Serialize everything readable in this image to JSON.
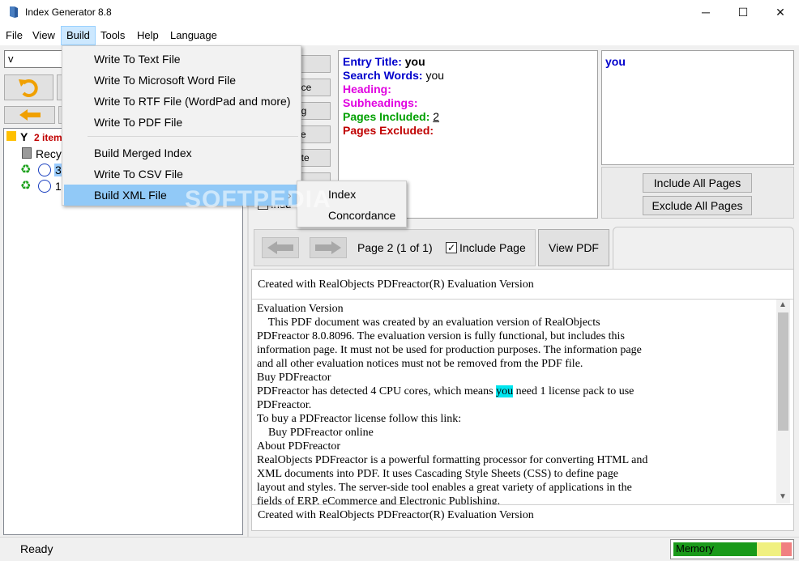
{
  "window": {
    "title": "Index Generator 8.8",
    "minimize": "─",
    "maximize": "☐",
    "close": "✕"
  },
  "menubar": {
    "items": [
      "File",
      "View",
      "Build",
      "Tools",
      "Help",
      "Language"
    ]
  },
  "left": {
    "combo_value": "v",
    "tree_root_letter": "Y",
    "tree_root_count": "2 item",
    "tree_item_recycle": "Recy",
    "tree_item_1": "3",
    "tree_item_2": "1"
  },
  "mid_buttons": [
    "y",
    "nce",
    "ng",
    "se",
    "ate",
    ""
  ],
  "mid_checkbox_label": "Indu",
  "entry": {
    "title_label": "Entry Title:",
    "title_value": "you",
    "search_label": "Search Words:",
    "search_value": "you",
    "heading_label": "Heading:",
    "subheadings_label": "Subheadings:",
    "included_label": "Pages Included:",
    "included_value": "2",
    "excluded_label": "Pages Excluded:",
    "colors": {
      "title": "#0000cc",
      "heading": "#e000e0",
      "included": "#00a000",
      "excluded": "#c00000"
    }
  },
  "right_list": {
    "item": "you"
  },
  "pages_buttons": {
    "include_all": "Include All Pages",
    "exclude_all": "Exclude All Pages"
  },
  "page_nav": {
    "page_label": "Page 2 (1 of 1)",
    "include_page_label": "Include Page",
    "include_checked": true,
    "view_pdf": "View PDF"
  },
  "pdf": {
    "header": "Created with RealObjects PDFreactor(R) Evaluation Version",
    "footer": "Created with RealObjects PDFreactor(R) Evaluation Version",
    "lines": [
      "Evaluation Version",
      "    This PDF document was created by an evaluation version of RealObjects",
      "PDFreactor 8.0.8096. The evaluation version is fully functional, but includes this",
      "information page. It must not be used for production purposes. The information page",
      "and all other evaluation notices must not be removed from the PDF file.",
      "Buy PDFreactor",
      "PDFreactor has detected 4 CPU cores, which means ",
      "PDFreactor.",
      "To buy a PDFreactor license follow this link:",
      "    Buy PDFreactor online",
      "About PDFreactor",
      "RealObjects PDFreactor is a powerful formatting processor for converting HTML and",
      "XML documents into PDF. It uses Cascading Style Sheets (CSS) to define page",
      "layout and styles. The server-side tool enables a great variety of applications in the",
      "fields of ERP, eCommerce and Electronic Publishing."
    ],
    "highlight_word": "you",
    "line7_tail": " need 1 license pack to use",
    "highlight_color": "#00e5ee"
  },
  "status": {
    "text": "Ready",
    "memory_label": "Memory"
  },
  "build_menu": {
    "items": [
      "Write To Text File",
      "Write To Microsoft Word File",
      "Write To RTF File (WordPad and more)",
      "Write To PDF File",
      "Build Merged Index",
      "Write To CSV File",
      "Build XML File"
    ],
    "submenu": [
      "Index",
      "Concordance"
    ],
    "submenu_arrow": "›"
  },
  "watermark": "SOFTPEDIA"
}
